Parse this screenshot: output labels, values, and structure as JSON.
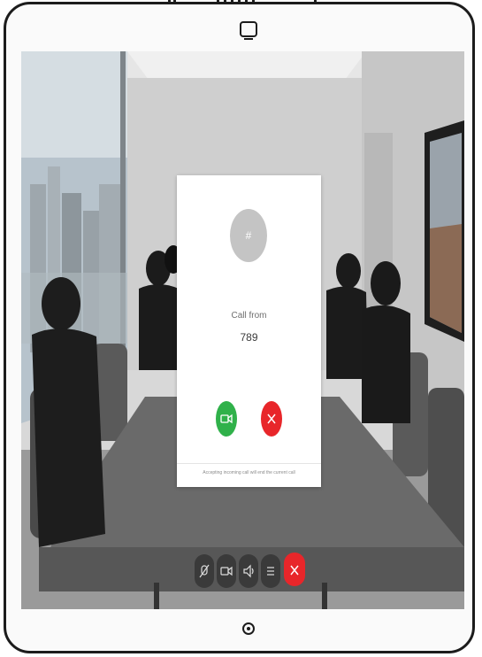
{
  "screen": {
    "call_card": {
      "avatar_glyph": "#",
      "call_from_label": "Call from",
      "caller_number": "789",
      "accept_icon": "video-camera-icon",
      "decline_icon": "close-icon",
      "footer_text": "Accepting incoming call will end the current call",
      "accept_color": "#30b14a",
      "decline_color": "#e8262a"
    },
    "control_bar": {
      "items": [
        {
          "icon": "mute-microphone-icon"
        },
        {
          "icon": "video-camera-icon"
        },
        {
          "icon": "volume-icon"
        },
        {
          "icon": "more-icon"
        },
        {
          "icon": "end-call-icon",
          "color": "#e8262a"
        }
      ]
    }
  },
  "device": {
    "top_button_icon": "square-button-icon",
    "home_button_icon": "home-button-icon"
  }
}
